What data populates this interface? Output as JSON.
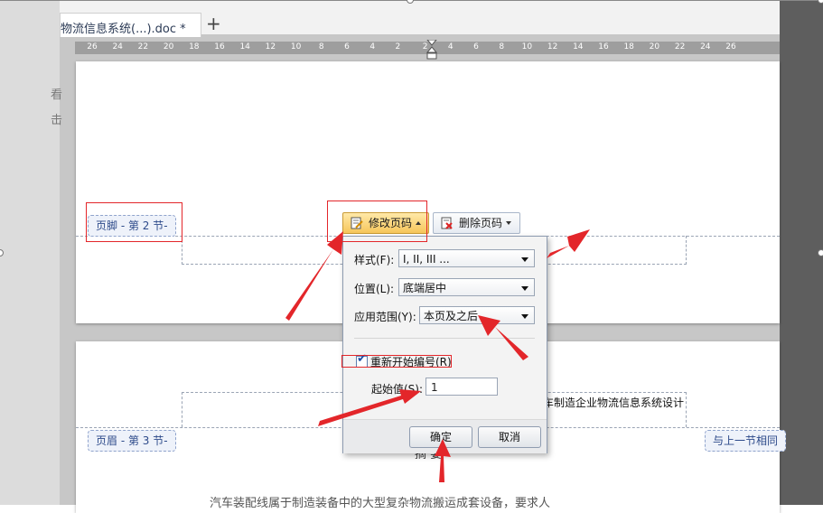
{
  "document_tab": {
    "title": "物流信息系统(...).doc *",
    "new_tab_icon": "plus-icon"
  },
  "ruler": {
    "ticks": [
      "26",
      "24",
      "22",
      "20",
      "18",
      "16",
      "14",
      "12",
      "10",
      "8",
      "6",
      "4",
      "2",
      "2",
      "4",
      "6",
      "8",
      "10",
      "12",
      "14",
      "16",
      "18",
      "20",
      "22",
      "24",
      "26"
    ]
  },
  "left_pane": {
    "glyph1": "看",
    "glyph2": "击"
  },
  "footer_section": {
    "label": "页脚 - 第 2 节-"
  },
  "header_section": {
    "label": "页眉 - 第 3 节-",
    "link_label": "与上一节相同"
  },
  "toolbar": {
    "modify_page_number": "修改页码",
    "delete_page_number": "删除页码",
    "modify_icon": "edit-page-icon",
    "delete_icon": "delete-page-icon"
  },
  "dialog": {
    "style_label": "样式(F):",
    "style_value": "I, II, III ...",
    "position_label": "位置(L):",
    "position_value": "底端居中",
    "scope_label": "应用范围(Y):",
    "scope_value": "本页及之后",
    "restart_label": "重新开始编号(R)",
    "restart_checked": true,
    "start_label": "起始值(S):",
    "start_value": "1",
    "ok_button": "确定",
    "cancel_button": "取消"
  },
  "document": {
    "header_text": "车制造企业物流信息系统设计",
    "heading_partial": "摘 要",
    "body_partial": "汽车装配线属于制造装备中的大型复杂物流搬运成套设备，要求人"
  },
  "annotation_color": "#e3262a"
}
